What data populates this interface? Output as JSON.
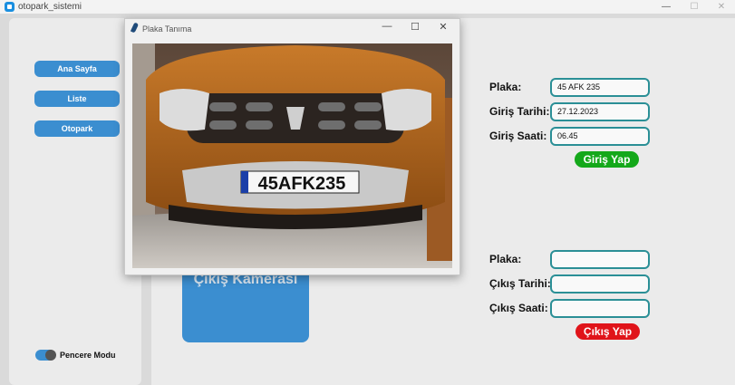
{
  "window": {
    "title": "otopark_sistemi",
    "minimize_glyph": "—",
    "maximize_glyph": "☐",
    "close_glyph": "✕"
  },
  "sidebar": {
    "buttons": [
      "Ana Sayfa",
      "Liste",
      "Otopark"
    ],
    "mode_switch_label": "Pencere Modu",
    "mode_switch_on": true
  },
  "exit_camera": {
    "label": "Çıkış Kamerası"
  },
  "entry_form": {
    "plate_label": "Plaka:",
    "plate_value": "45 AFK 235",
    "date_label": "Giriş Tarihi:",
    "date_value": "27.12.2023",
    "time_label": "Giriş Saati:",
    "time_value": "06.45",
    "submit_label": "Giriş Yap",
    "submit_color": "#14a81a"
  },
  "exit_form": {
    "plate_label": "Plaka:",
    "plate_value": "",
    "date_label": "Çıkış Tarihi:",
    "date_value": "",
    "time_label": "Çıkış Saati:",
    "time_value": "",
    "submit_label": "Çıkış Yap",
    "submit_color": "#e0141a"
  },
  "popup": {
    "title": "Plaka Tanıma",
    "minimize_glyph": "—",
    "maximize_glyph": "☐",
    "close_glyph": "✕",
    "plate_text": "45AFK235"
  },
  "colors": {
    "accent": "#3b8ed0",
    "field_border": "#2b8f96"
  }
}
